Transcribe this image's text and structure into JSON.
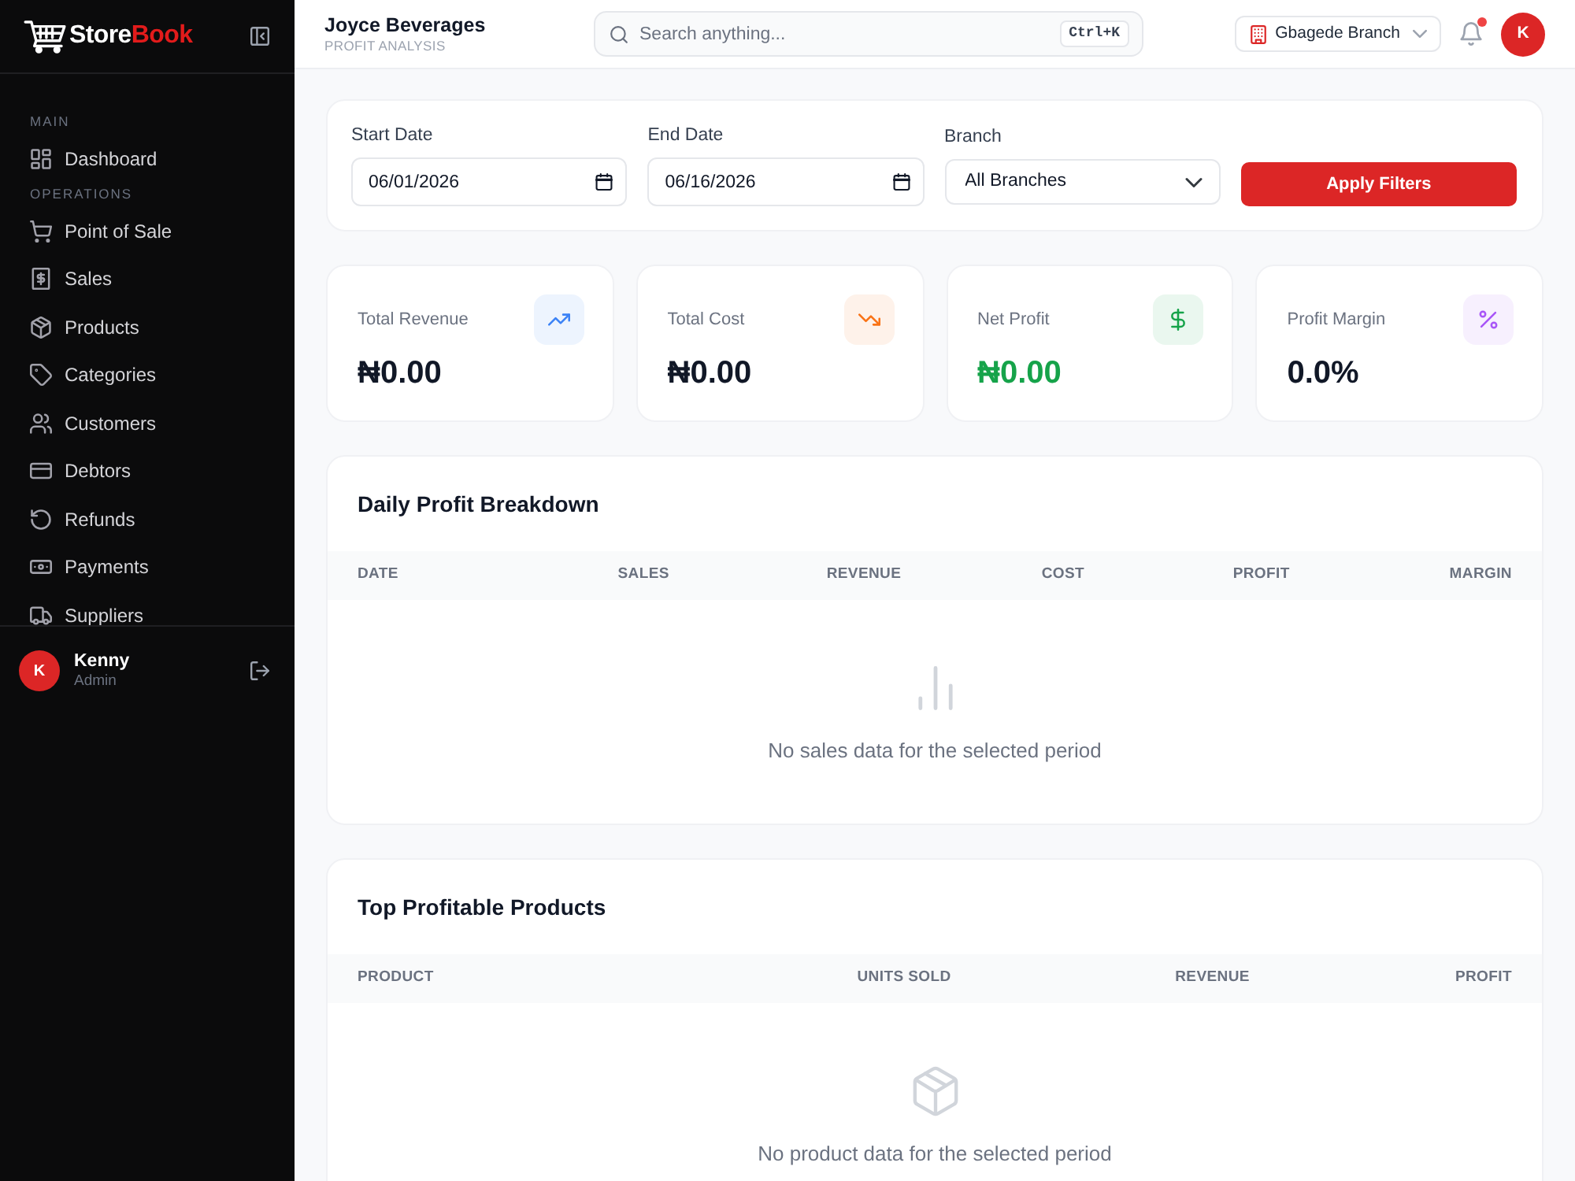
{
  "sidebar": {
    "brand": {
      "first": "Store",
      "second": "Book"
    },
    "sections": [
      {
        "heading": "MAIN",
        "items": [
          {
            "label": "Dashboard",
            "selected": false
          }
        ]
      },
      {
        "heading": "OPERATIONS",
        "items": [
          {
            "label": "Point of Sale",
            "selected": false
          },
          {
            "label": "Sales",
            "selected": false
          },
          {
            "label": "Products",
            "selected": false
          },
          {
            "label": "Categories",
            "selected": false
          },
          {
            "label": "Customers",
            "selected": false
          },
          {
            "label": "Debtors",
            "selected": false
          },
          {
            "label": "Refunds",
            "selected": false
          },
          {
            "label": "Payments",
            "selected": false
          },
          {
            "label": "Suppliers",
            "selected": false
          }
        ]
      }
    ],
    "user": {
      "initial": "K",
      "name": "Kenny",
      "role": "Admin"
    }
  },
  "topbar": {
    "title": "Joyce Beverages",
    "subtitle": "PROFIT ANALYSIS",
    "search": {
      "placeholder": "Search anything...",
      "shortcut": "Ctrl+K"
    },
    "branch": "Gbagede Branch",
    "notifications": {
      "unread": true
    },
    "avatar": "K"
  },
  "filters": {
    "fields": [
      {
        "kind": "date",
        "label": "Start Date",
        "value": "06/01/2026"
      },
      {
        "kind": "date",
        "label": "End Date",
        "value": "06/16/2026"
      },
      {
        "kind": "select",
        "label": "Branch",
        "value": "All Branches"
      }
    ],
    "apply_button": "Apply Filters"
  },
  "stats": [
    {
      "label": "Total Revenue",
      "value": "₦0.00",
      "color": "#3b82f6",
      "positive": false
    },
    {
      "label": "Total Cost",
      "value": "₦0.00",
      "color": "#f97316",
      "positive": false
    },
    {
      "label": "Net Profit",
      "value": "₦0.00",
      "color": "#16a34a",
      "positive": true
    },
    {
      "label": "Profit Margin",
      "value": "0.0%",
      "color": "#a855f7",
      "positive": false
    }
  ],
  "tables": [
    {
      "title": "Daily Profit Breakdown",
      "columns": [
        "DATE",
        "SALES",
        "REVENUE",
        "COST",
        "PROFIT",
        "MARGIN"
      ],
      "empty_message": "No sales data for the selected period"
    },
    {
      "title": "Top Profitable Products",
      "columns": [
        "PRODUCT",
        "UNITS SOLD",
        "REVENUE",
        "PROFIT"
      ],
      "empty_message": "No product data for the selected period"
    }
  ]
}
